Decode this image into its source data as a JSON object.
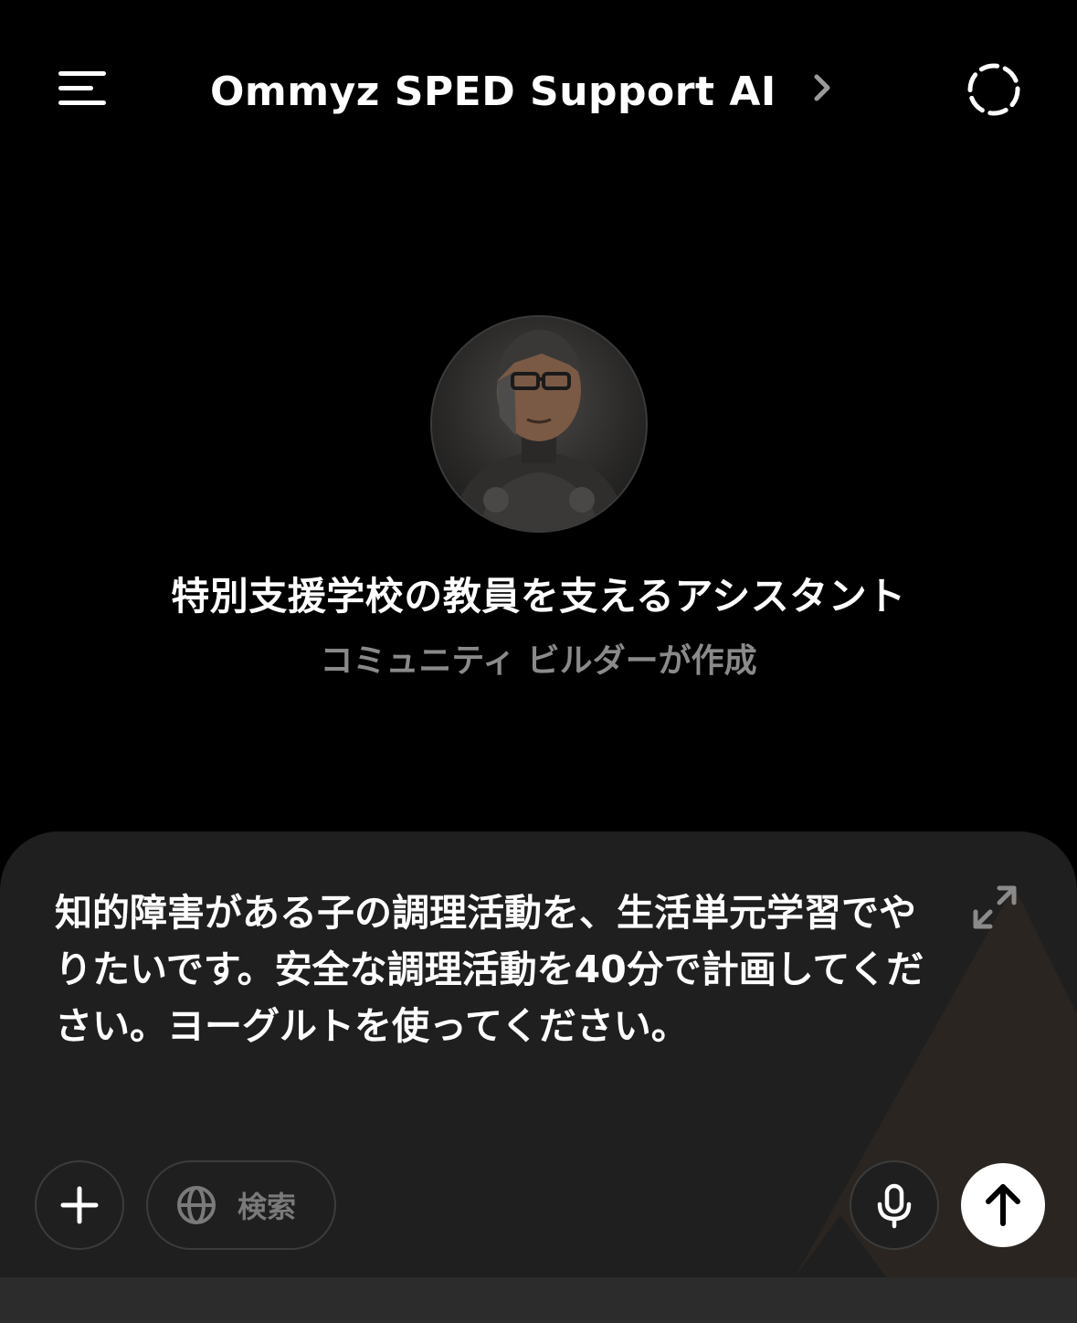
{
  "header": {
    "title": "Ommyz SPED Support AI（…",
    "menu_icon": "hamburger-menu-icon",
    "chevron_icon": "chevron-right-icon",
    "new_chat_icon": "dashed-circle-icon"
  },
  "gpt": {
    "description": "特別支援学校の教員を支えるアシスタント",
    "author": "コミュニティ ビルダーが作成",
    "avatar_icon": "gpt-avatar"
  },
  "composer": {
    "message": "知的障害がある子の調理活動を、生活単元学習でやりたいです。安全な調理活動を40分で計画してください。ヨーグルトを使ってください。",
    "expand_icon": "expand-arrows-icon",
    "attach_icon": "plus-icon",
    "search_label": "検索",
    "search_icon": "globe-icon",
    "mic_icon": "microphone-icon",
    "send_icon": "arrow-up-icon"
  },
  "colors": {
    "background": "#000000",
    "composer": "#1f1f1f",
    "muted_text": "#8a8a8a",
    "send_button": "#ffffff"
  }
}
